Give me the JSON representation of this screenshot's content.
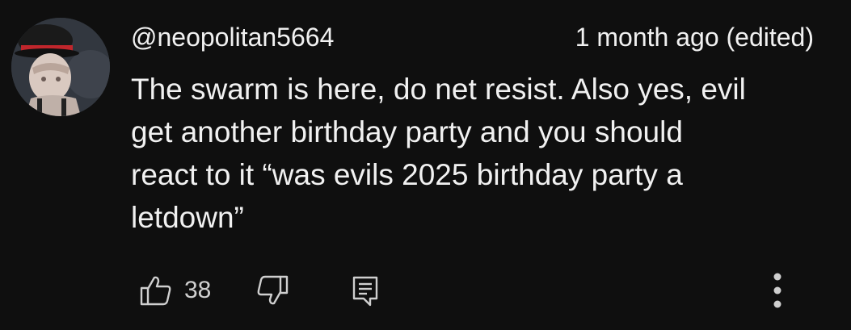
{
  "comment": {
    "author": "@neopolitan5664",
    "timestamp": "1 month ago (edited)",
    "text_lines": [
      "The swarm is here, do net resist. Also yes, evil",
      "get another birthday party and you should",
      "react to it “was evils 2025 birthday party a",
      "letdown”"
    ],
    "like_count": "38"
  },
  "icons": {
    "like": "thumbs-up-icon",
    "dislike": "thumbs-down-icon",
    "reply": "reply-comment-icon",
    "more": "more-vertical-icon"
  }
}
